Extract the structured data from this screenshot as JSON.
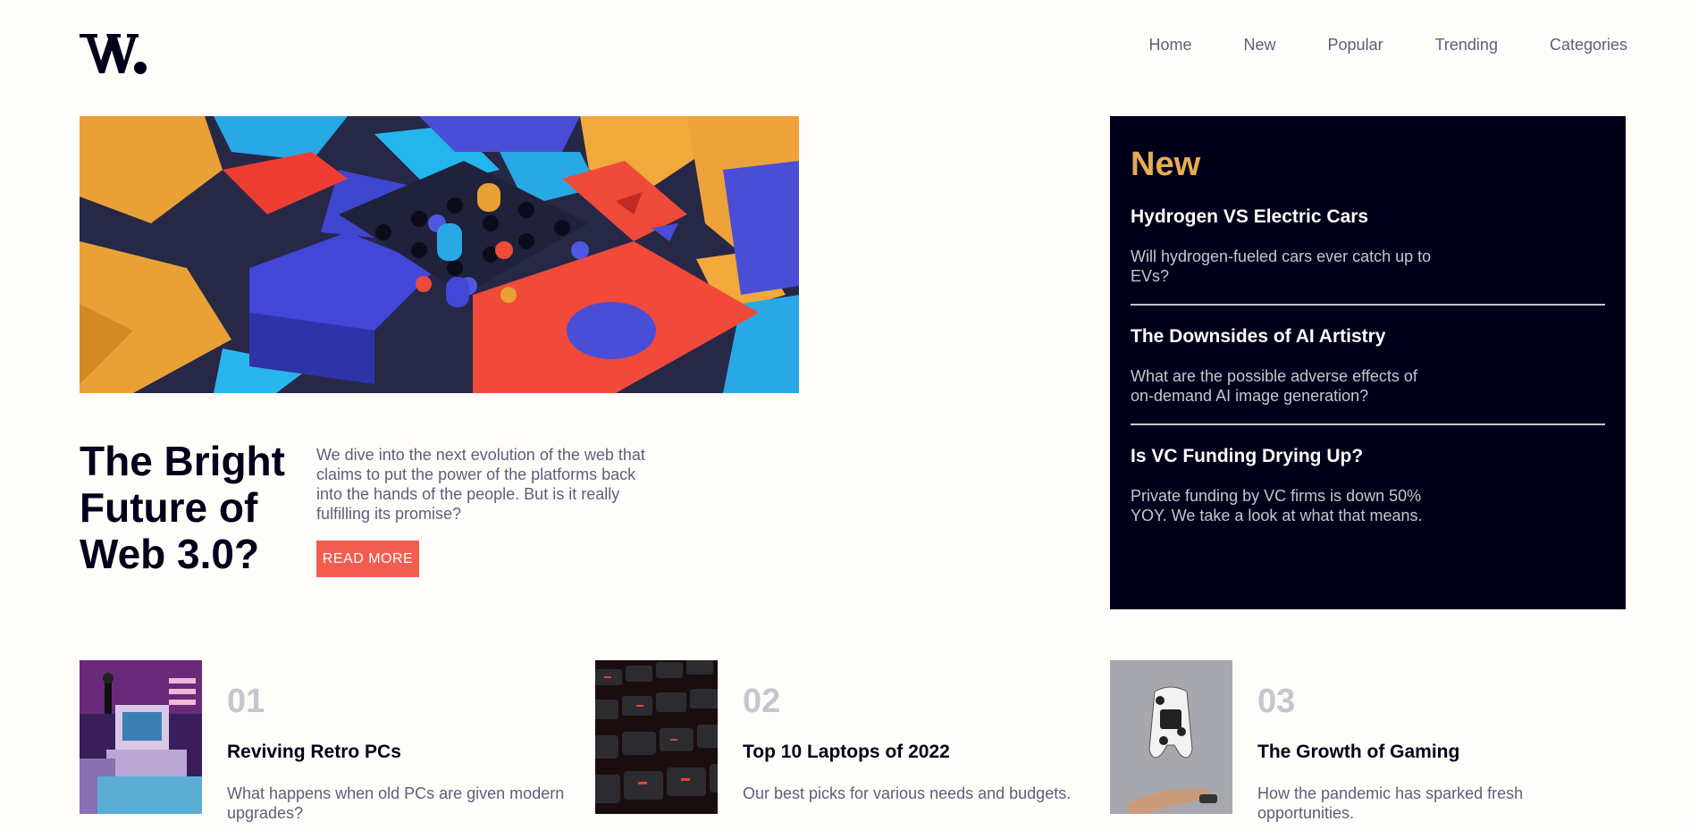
{
  "brand": {
    "logo_text": "W."
  },
  "nav": {
    "items": [
      "Home",
      "New",
      "Popular",
      "Trending",
      "Categories"
    ]
  },
  "hero": {
    "title": "The Bright Future of Web 3.0?",
    "description": "We dive into the next evolution of the web that claims to put the power of the platforms back into the hands of the people. But is it really fulfilling its promise?",
    "button_label": "READ MORE",
    "image_icon": "hero-3d-blocks-image"
  },
  "new_panel": {
    "heading": "New",
    "items": [
      {
        "title": "Hydrogen VS Electric Cars",
        "desc": "Will hydrogen-fueled cars ever catch up to EVs?"
      },
      {
        "title": "The Downsides of AI Artistry",
        "desc": "What are the possible adverse effects of on-demand AI image generation?"
      },
      {
        "title": "Is VC Funding Drying Up?",
        "desc": "Private funding by VC firms is down 50% YOY. We take a look at what that means."
      }
    ]
  },
  "cards": [
    {
      "num": "01",
      "title": "Reviving Retro PCs",
      "desc": "What happens when old PCs are given modern upgrades?",
      "image_icon": "retro-pc-image"
    },
    {
      "num": "02",
      "title": "Top 10 Laptops of 2022",
      "desc": "Our best picks for various needs and budgets.",
      "image_icon": "keyboard-image"
    },
    {
      "num": "03",
      "title": "The Growth of Gaming",
      "desc": "How the pandemic has sparked fresh opportunities.",
      "image_icon": "gamepad-image"
    }
  ],
  "colors": {
    "accent_orange": "#e9ab53",
    "accent_red": "#f15e50",
    "dark_navy": "#00001a",
    "grayish_blue": "#5d5f79",
    "light_gray": "#c5c6ce",
    "off_white": "#fffdfa"
  }
}
